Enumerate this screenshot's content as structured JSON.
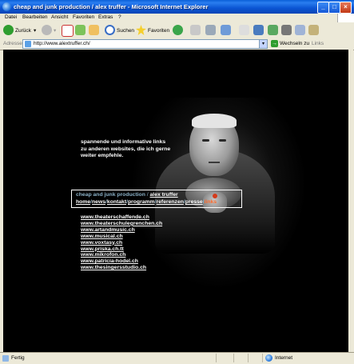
{
  "window": {
    "title": "cheap and junk production / alex truffer - Microsoft Internet Explorer"
  },
  "menu": {
    "items": [
      "Datei",
      "Bearbeiten",
      "Ansicht",
      "Favoriten",
      "Extras",
      "?"
    ]
  },
  "toolbar": {
    "back_label": "Zurück",
    "search_label": "Suchen",
    "favorites_label": "Favoriten"
  },
  "address": {
    "label": "Adresse",
    "url": "http://www.alextruffer.ch/",
    "go_label": "Wechseln zu",
    "links_label": "Links"
  },
  "page": {
    "intro": [
      "spannende und informative links",
      "zu anderen websites, die ich gerne",
      "weiter empfehle."
    ],
    "nav": {
      "production": "cheap and junk production",
      "separator": "/",
      "author": "alex truffer",
      "links": [
        "home",
        "news",
        "kontakt",
        "programm",
        "referenzen",
        "presse",
        "links"
      ]
    },
    "external_links": [
      "www.theaterschaffende.ch",
      "www.theaterschulegrenchen.ch",
      "www.artandmusic.ch",
      "www.musical.ch",
      "www.voxtasy.ch",
      "www.priska.ch.tt",
      "www.mikrofon.ch",
      "www.patricia-hodel.ch",
      "www.thesingersstudio.ch"
    ]
  },
  "status": {
    "text": "Fertig",
    "zone": "Internet"
  },
  "colors": {
    "titlebar": "#0b54d3",
    "content_bg": "#000000",
    "nav_accent": "#8ab0c6",
    "active_link": "#ff6a2a"
  }
}
